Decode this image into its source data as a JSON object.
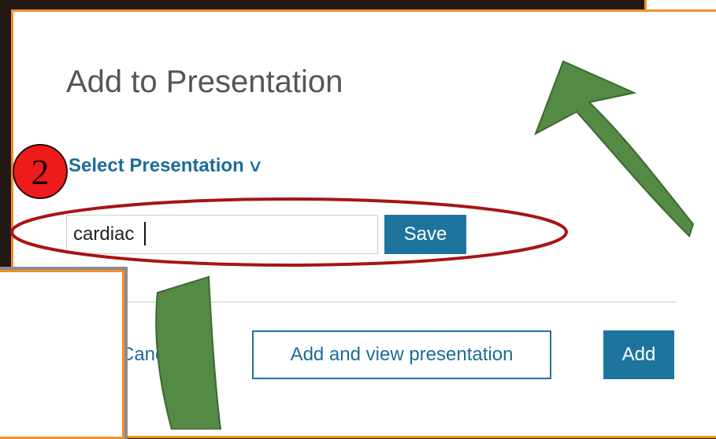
{
  "dialog": {
    "title": "Add to Presentation",
    "select_label": "Select Presentation",
    "select_chevron": "∨",
    "name_input_value": "cardiac",
    "save_label": "Save",
    "cancel_label": "Cancel",
    "add_view_label": "Add and view presentation",
    "add_label": "Add"
  },
  "annotation": {
    "step_number": "2"
  },
  "colors": {
    "accent": "#1d759e",
    "frame_border": "#f0902a",
    "highlight_ellipse": "#a81414",
    "arrow": "#548a44",
    "badge": "#ee1b1b"
  }
}
